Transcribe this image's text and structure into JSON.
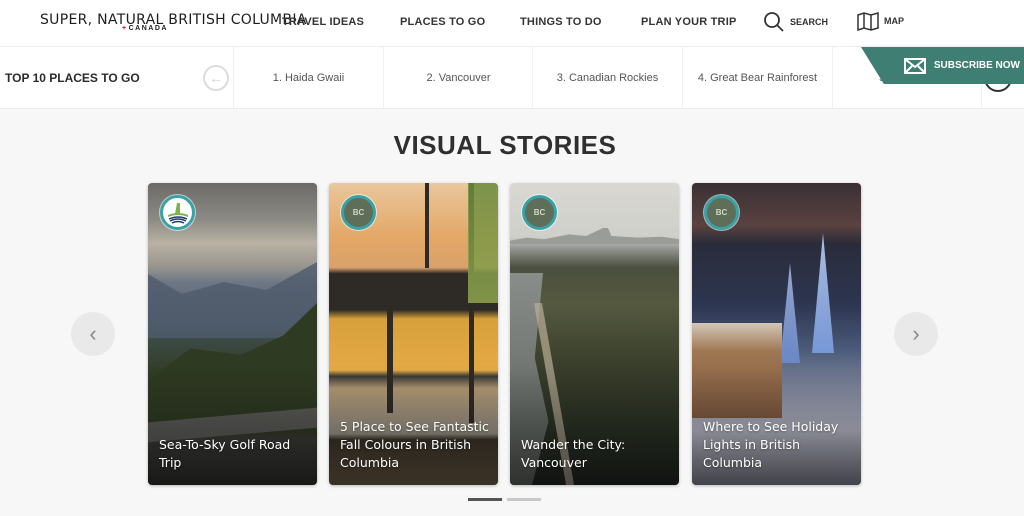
{
  "header": {
    "logo_main": "SUPER, NATURAL BRITISH COLUMBIA",
    "logo_sub_mark": "+",
    "logo_sub": "CANADA",
    "nav": [
      {
        "label": "TRAVEL IDEAS"
      },
      {
        "label": "PLACES TO GO"
      },
      {
        "label": "THINGS TO DO"
      },
      {
        "label": "PLAN YOUR TRIP"
      }
    ],
    "search_label": "SEARCH",
    "map_label": "MAP"
  },
  "top10": {
    "title": "TOP 10 PLACES TO GO",
    "prev_icon": "arrow-left-circle-icon",
    "items": [
      {
        "label": "1. Haida Gwaii"
      },
      {
        "label": "2. Vancouver"
      },
      {
        "label": "3. Canadian Rockies"
      },
      {
        "label": "4. Great Bear Rainforest"
      },
      {
        "label": "5."
      }
    ]
  },
  "subscribe": {
    "label": "SUBSCRIBE NOW",
    "icon": "envelope-icon",
    "color": "#3f7e72"
  },
  "visual_stories": {
    "title": "VISUAL STORIES",
    "prev_glyph": "‹",
    "next_glyph": "›",
    "cards": [
      {
        "title": "Sea-To-Sky Golf Road Trip",
        "badge": "golf-badge",
        "badge_text": ""
      },
      {
        "title": "5 Place to See Fantastic Fall Colours in British Columbia",
        "badge": "bc-leaf-badge",
        "badge_text": "BC"
      },
      {
        "title": "Wander the City: Vancouver",
        "badge": "bc-leaf-badge",
        "badge_text": "BC"
      },
      {
        "title": "Where to See Holiday Lights in British Columbia",
        "badge": "bc-leaf-badge",
        "badge_text": "BC"
      }
    ],
    "pagination": {
      "current": 1,
      "total": 2
    }
  }
}
